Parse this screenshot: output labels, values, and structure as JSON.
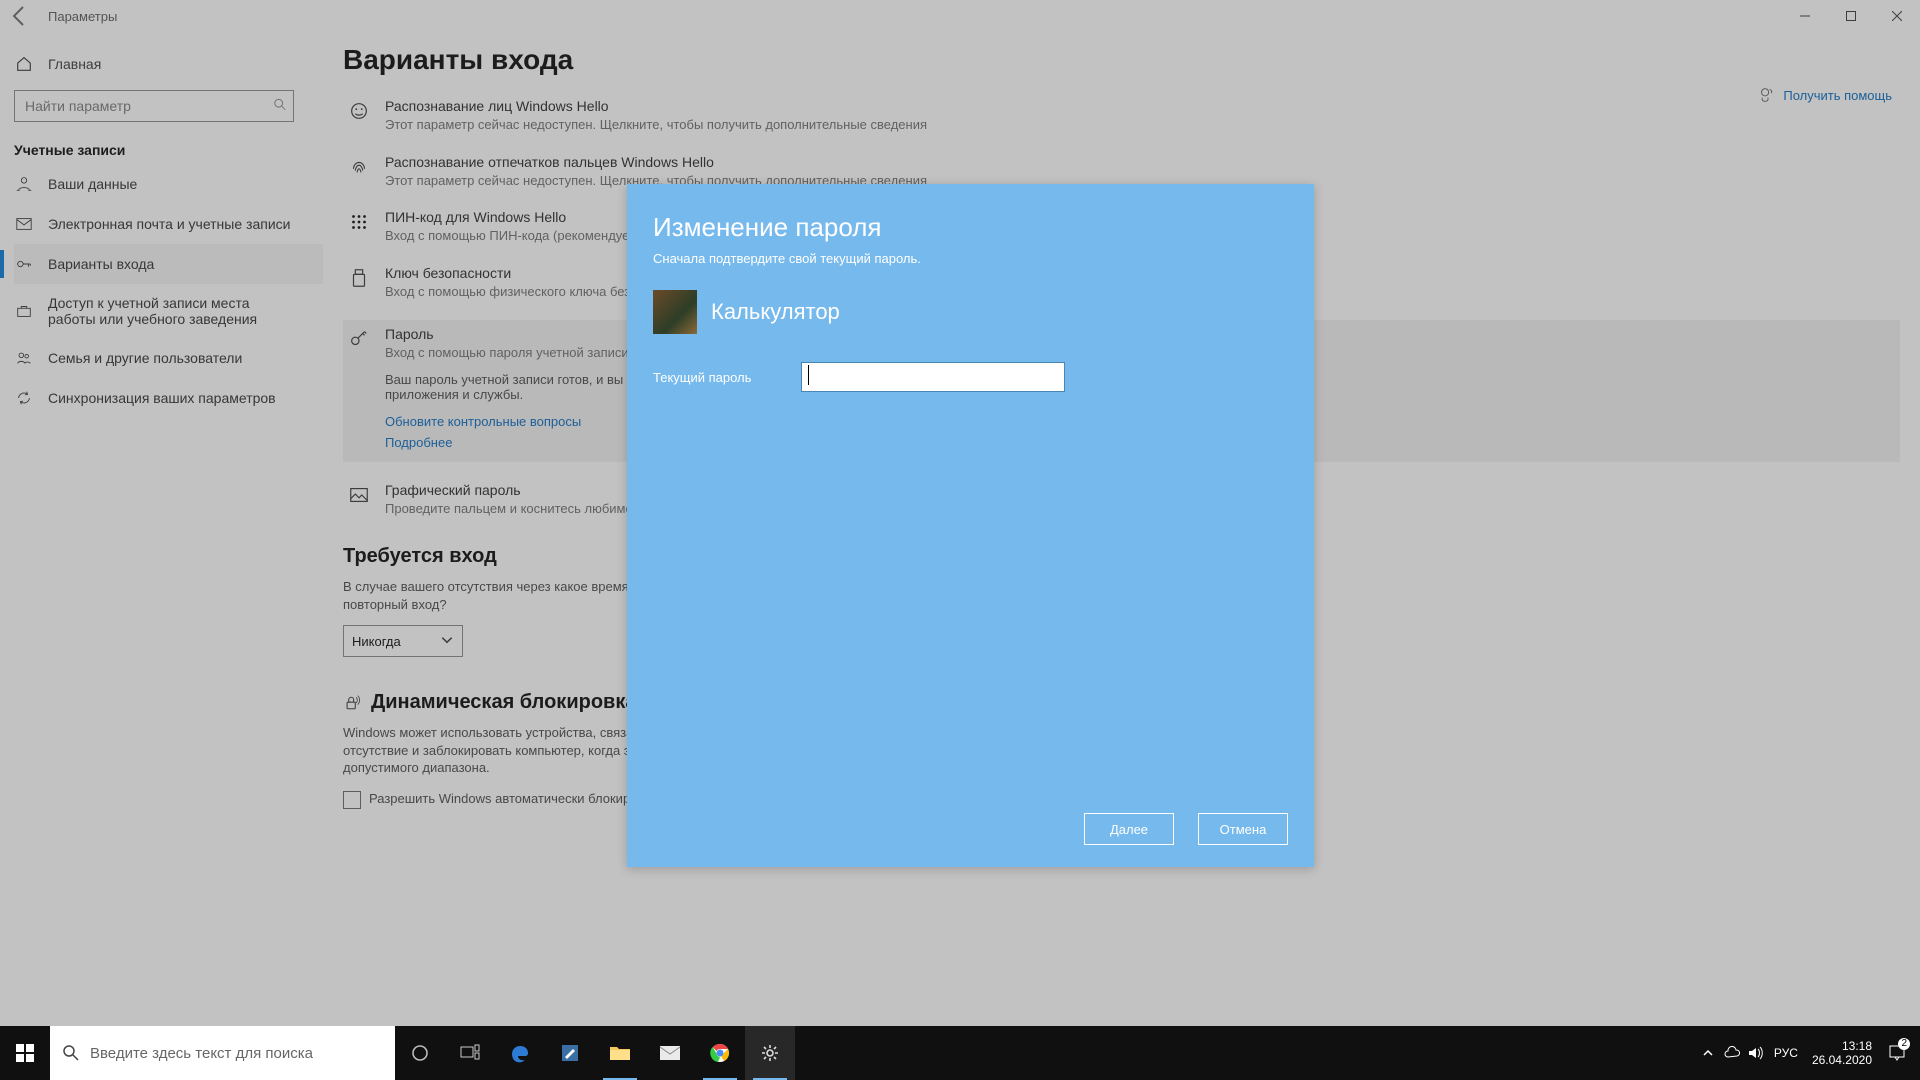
{
  "titlebar": {
    "title": "Параметры"
  },
  "sidebar": {
    "home": "Главная",
    "search_placeholder": "Найти параметр",
    "section": "Учетные записи",
    "items": [
      {
        "label": "Ваши данные"
      },
      {
        "label": "Электронная почта и учетные записи"
      },
      {
        "label": "Варианты входа"
      },
      {
        "label": "Доступ к учетной записи места работы или учебного заведения"
      },
      {
        "label": "Семья и другие пользователи"
      },
      {
        "label": "Синхронизация ваших параметров"
      }
    ]
  },
  "page": {
    "title": "Варианты входа",
    "help_link": "Получить помощь",
    "options": [
      {
        "title": "Распознавание лиц Windows Hello",
        "desc": "Этот параметр сейчас недоступен. Щелкните, чтобы получить дополнительные сведения"
      },
      {
        "title": "Распознавание отпечатков пальцев Windows Hello",
        "desc": "Этот параметр сейчас недоступен. Щелкните, чтобы получить дополнительные сведения"
      },
      {
        "title": "ПИН-код для Windows Hello",
        "desc": "Вход с помощью ПИН-кода (рекомендуется)"
      },
      {
        "title": "Ключ безопасности",
        "desc": "Вход с помощью физического ключа безопасности"
      },
      {
        "title": "Пароль",
        "desc": "Вход с помощью пароля учетной записи",
        "sub": "Ваш пароль учетной записи готов, и вы можете с помощью него входили в Windows, приложения и службы.",
        "link1": "Обновите контрольные вопросы",
        "link2": "Подробнее"
      },
      {
        "title": "Графический пароль",
        "desc": "Проведите пальцем и коснитесь любимой фотографии, чтобы разблокировать устройство"
      }
    ],
    "require_signin": {
      "heading": "Требуется вход",
      "body": "В случае вашего отсутствия через какое время Windows должна потребовать выполнить повторный вход?",
      "value": "Никогда"
    },
    "dynamic_lock": {
      "heading": "Динамическая блокировка",
      "body": "Windows может использовать устройства, связанные с компьютером, чтобы определить отсутствие и заблокировать компьютер, когда эти устройства выйдут за пределы допустимого диапазона.",
      "checkbox": "Разрешить Windows автоматически блокировать устройство"
    }
  },
  "modal": {
    "title": "Изменение пароля",
    "subtitle": "Сначала подтвердите свой текущий пароль.",
    "user": "Калькулятор",
    "field_label": "Текущий пароль",
    "next": "Далее",
    "cancel": "Отмена"
  },
  "taskbar": {
    "search_placeholder": "Введите здесь текст для поиска",
    "lang": "РУС",
    "time": "13:18",
    "date": "26.04.2020",
    "notif_count": "2"
  }
}
